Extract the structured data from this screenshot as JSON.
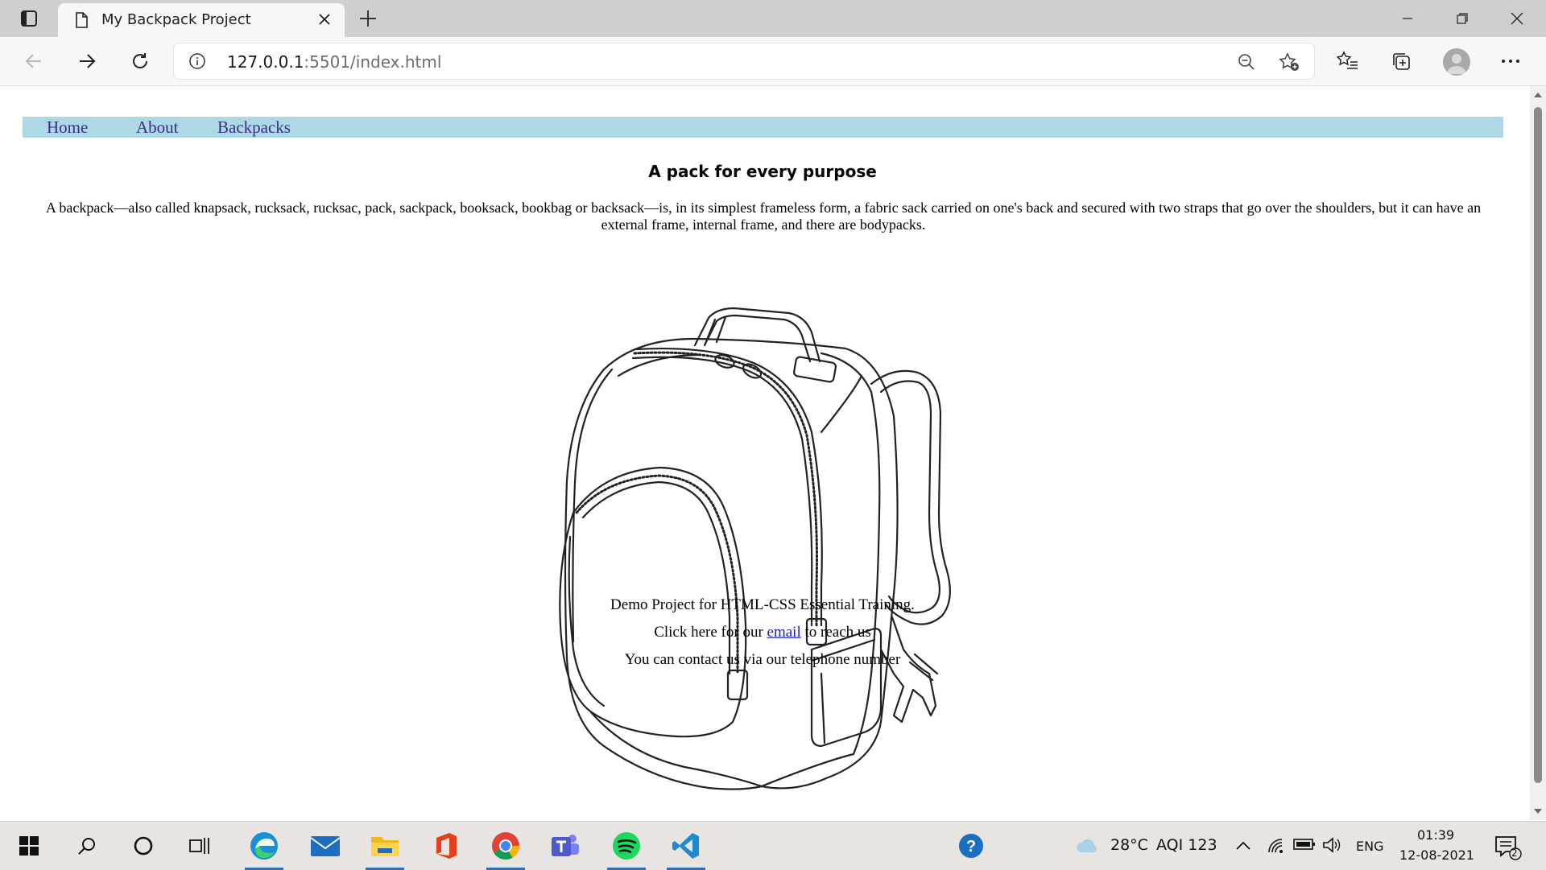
{
  "browser": {
    "tab_title": "My Backpack Project",
    "url_host": "127.0.0.1",
    "url_rest": ":5501/index.html"
  },
  "page": {
    "nav": [
      "Home",
      "About",
      "Backpacks"
    ],
    "heading": "A pack for every purpose",
    "intro": "A backpack—also called knapsack, rucksack, rucksac, pack, sackpack, booksack, bookbag or backsack—is, in its simplest frameless form, a fabric sack carried on one's back and secured with two straps that go over the shoulders, but it can have an external frame, internal frame, and there are bodypacks.",
    "footer_demo": "Demo Project for HTML-CSS Essential Training.",
    "footer_email_prefix": "Click here for our ",
    "footer_email_link": "email",
    "footer_email_suffix": " to reach us",
    "footer_phone": "You can contact us via our telephone number"
  },
  "taskbar": {
    "weather": "28°C",
    "aqi": "AQI 123",
    "language": "ENG",
    "time": "01:39",
    "date": "12-08-2021",
    "notifications": "2"
  },
  "colors": {
    "nav_bg": "#add8e6",
    "nav_link": "#3a2c8a",
    "email_link": "#1d1dbd"
  }
}
